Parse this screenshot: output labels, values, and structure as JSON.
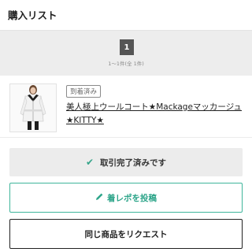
{
  "header": {
    "title": "購入リスト"
  },
  "pagination": {
    "current_page": "1",
    "summary": "1～1件(全 1件)"
  },
  "item": {
    "badge": "到着済み",
    "title": "美人極上ウールコート★Mackageマッカージュ★KITTY★",
    "thumbnail_icon": "white-coat-photo"
  },
  "actions": {
    "done_label": "取引完了済みです",
    "done_icon": "check-icon",
    "review_label": "着レポを投稿",
    "review_icon": "pencil-icon",
    "request_label": "同じ商品をリクエスト"
  },
  "colors": {
    "accent": "#3fb59b",
    "done_bg": "#ececec"
  }
}
